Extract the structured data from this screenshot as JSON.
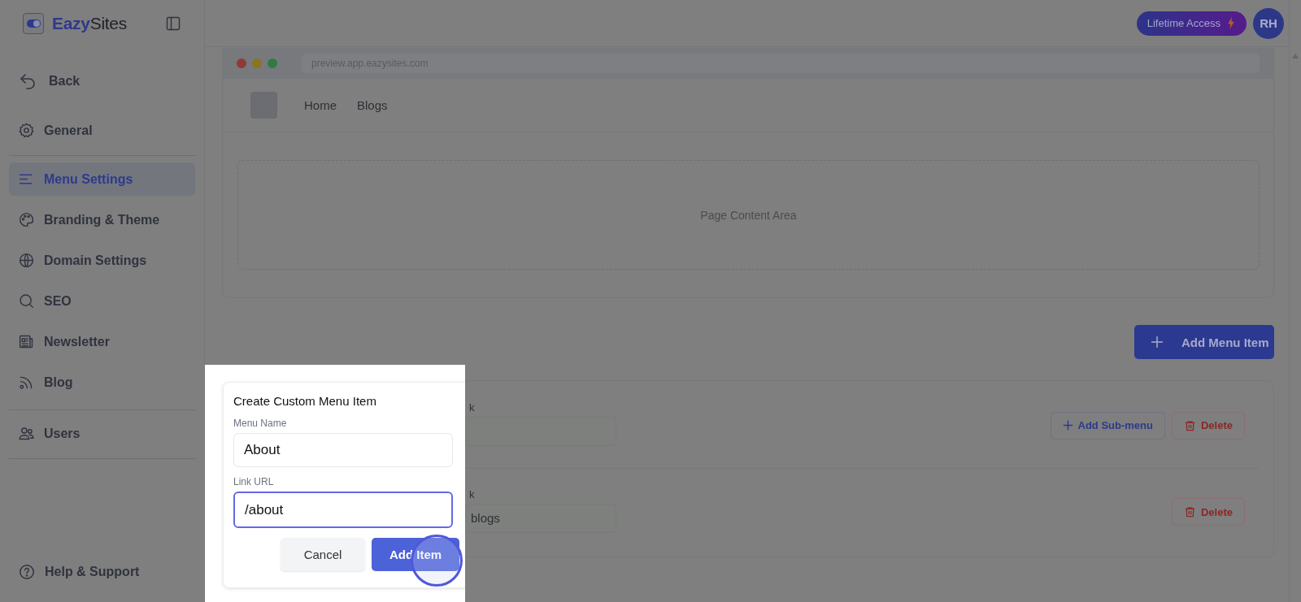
{
  "sidebar": {
    "brand": "**Eazy**Sites",
    "back": "Back",
    "sections": [
      {
        "items": [
          {
            "label": "General",
            "selected": false
          }
        ]
      },
      {
        "items": [
          {
            "label": "Menu Settings",
            "selected": true
          },
          {
            "label": "Branding & Theme",
            "selected": false
          },
          {
            "label": "Domain Settings",
            "selected": false
          },
          {
            "label": "SEO",
            "selected": false
          },
          {
            "label": "Newsletter",
            "selected": false
          },
          {
            "label": "Blog",
            "selected": false
          }
        ]
      },
      {
        "items": [
          {
            "label": "Users",
            "selected": false
          }
        ]
      }
    ],
    "help": "Help & Support"
  },
  "topbar": {
    "plan_badge": "Lifetime Access",
    "avatar": "RH"
  },
  "preview": {
    "url": "preview.app.eazysites.com",
    "nav": [
      "Home",
      "Blogs"
    ],
    "content_placeholder": "Page Content Area"
  },
  "add_button": "Add Menu Item",
  "menu_items": [
    {
      "link_label": "k",
      "actions": [
        {
          "kind": "add",
          "label": "Add Sub-menu"
        },
        {
          "kind": "delete",
          "label": "Delete"
        }
      ]
    },
    {
      "link_label": "k",
      "link_value": "blogs",
      "actions": [
        {
          "kind": "delete",
          "label": "Delete"
        }
      ]
    }
  ],
  "dialog": {
    "title": "Create Custom Menu Item",
    "fields": [
      {
        "label": "Menu Name",
        "value": "About",
        "focused": false
      },
      {
        "label": "Link URL",
        "value": "/about",
        "focused": true
      }
    ],
    "buttons": [
      {
        "kind": "secondary",
        "label": "Cancel"
      },
      {
        "kind": "primary",
        "label": "Add Item"
      }
    ]
  }
}
